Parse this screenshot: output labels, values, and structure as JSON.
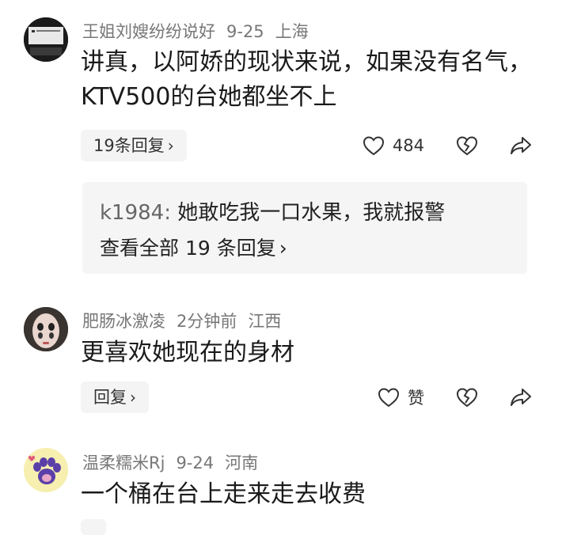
{
  "comments": [
    {
      "username": "王姐刘嫂纷纷说好",
      "date": "9-25",
      "location": "上海",
      "text_line1": "讲真，以阿娇的现状来说，如果没有名气，",
      "text_line2": "KTV500的台她都坐不上",
      "reply_label": "19条回复",
      "like_count": "484",
      "sub_reply": {
        "username": "k1984:",
        "text": "她敢吃我一口水果，我就报警",
        "view_all": "查看全部 19 条回复"
      }
    },
    {
      "username": "肥肠冰激凌",
      "date": "2分钟前",
      "location": "江西",
      "text_line1": "更喜欢她现在的身材",
      "reply_label": "回复",
      "like_label": "赞"
    },
    {
      "username": "温柔糯米Rj",
      "date": "9-24",
      "location": "河南",
      "text_line1": "一个桶在台上走来走去收费"
    }
  ],
  "icons": {
    "chevron": "›",
    "like": "heart-outline-icon",
    "dislike": "broken-heart-icon",
    "share": "share-arrow-icon"
  },
  "colors": {
    "meta": "#777777",
    "text": "#1a1a1a",
    "pill_bg": "#f4f4f4",
    "sub_box_bg": "#f5f5f5"
  }
}
